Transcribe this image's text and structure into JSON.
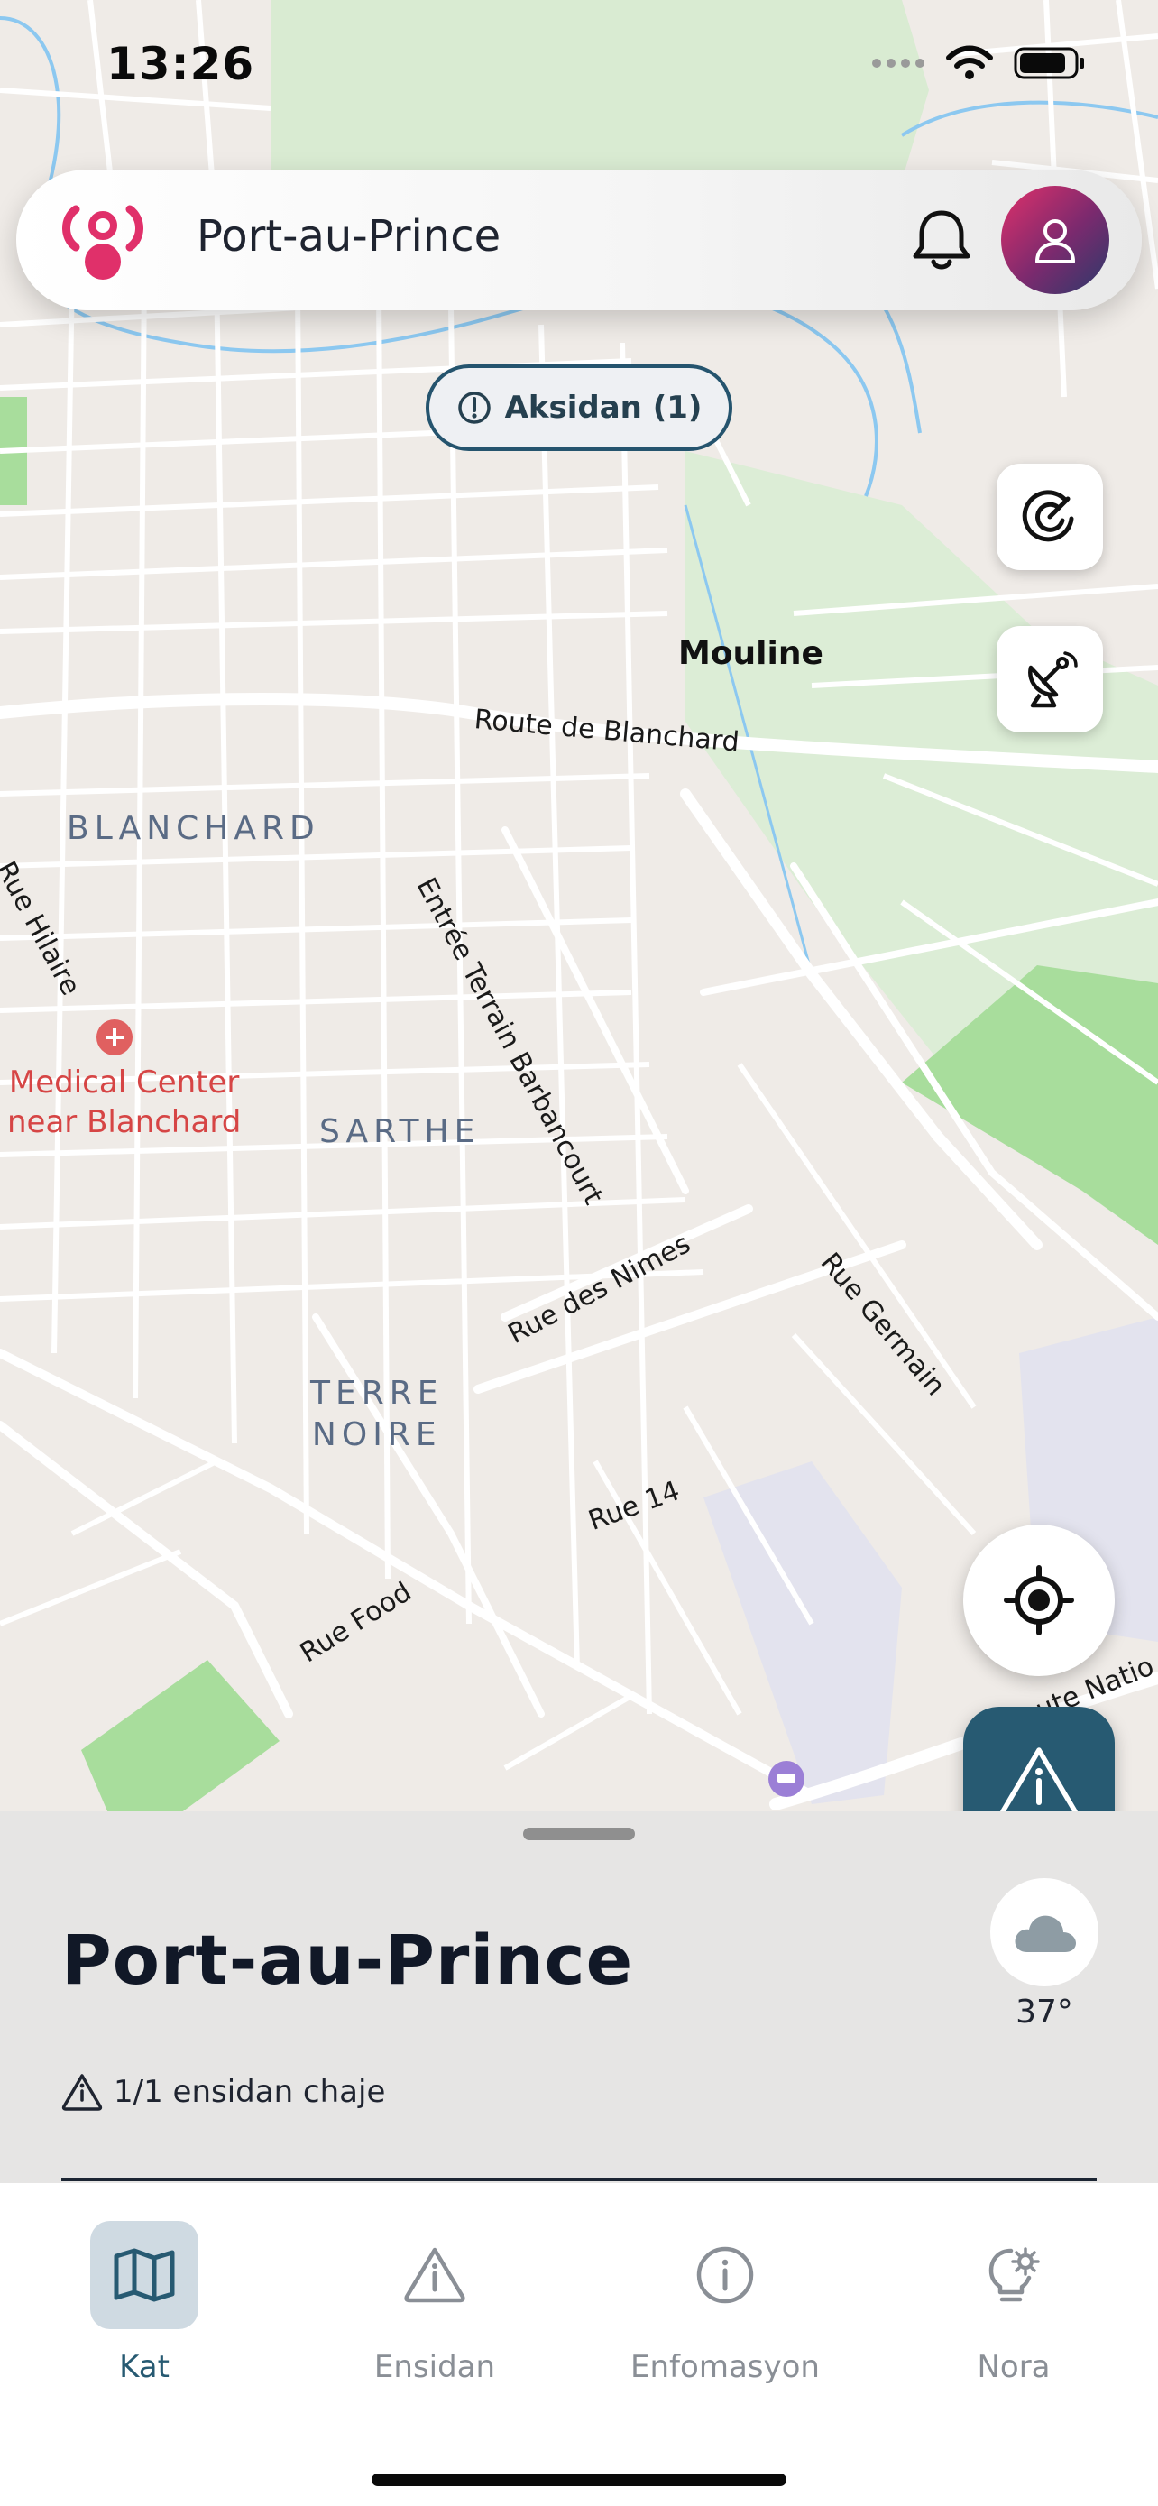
{
  "status_bar": {
    "time": "13:26"
  },
  "search": {
    "location": "Port-au-Prince"
  },
  "incident_chip": {
    "label": "Aksidan (1)"
  },
  "map_labels": {
    "mouline": "Mouline",
    "route_blanchard": "Route de Blanchard",
    "blanchard": "BLANCHARD",
    "rue_hilaire": "Rue Hilaire",
    "medical_center_line1": "Medical Center",
    "medical_center_line2": "near Blanchard",
    "entree_terrain": "Entrée Terrain Barbancourt",
    "sarthe": "SARTHE",
    "rue_des_nimes": "Rue des Nimes",
    "rue_germain": "Rue Germain",
    "terre_line1": "TERRE",
    "terre_line2": "NOIRE",
    "rue_14": "Rue 14",
    "rue_food": "Rue Food",
    "route_nationale": "ute Natio"
  },
  "sheet": {
    "title": "Port-au-Prince",
    "subtitle": "1/1 ensidan chaje",
    "temperature": "37°"
  },
  "tabs": [
    {
      "label": "Kat",
      "icon": "map-icon",
      "active": true
    },
    {
      "label": "Ensidan",
      "icon": "warning-icon",
      "active": false
    },
    {
      "label": "Enfomasyon",
      "icon": "info-icon",
      "active": false
    },
    {
      "label": "Nora",
      "icon": "bulb-gear-icon",
      "active": false
    }
  ],
  "colors": {
    "accent": "#275a72",
    "brand": "#e0306a",
    "map_background": "#efebe7",
    "park": "#d8eccf",
    "water": "#8cc8f0"
  }
}
